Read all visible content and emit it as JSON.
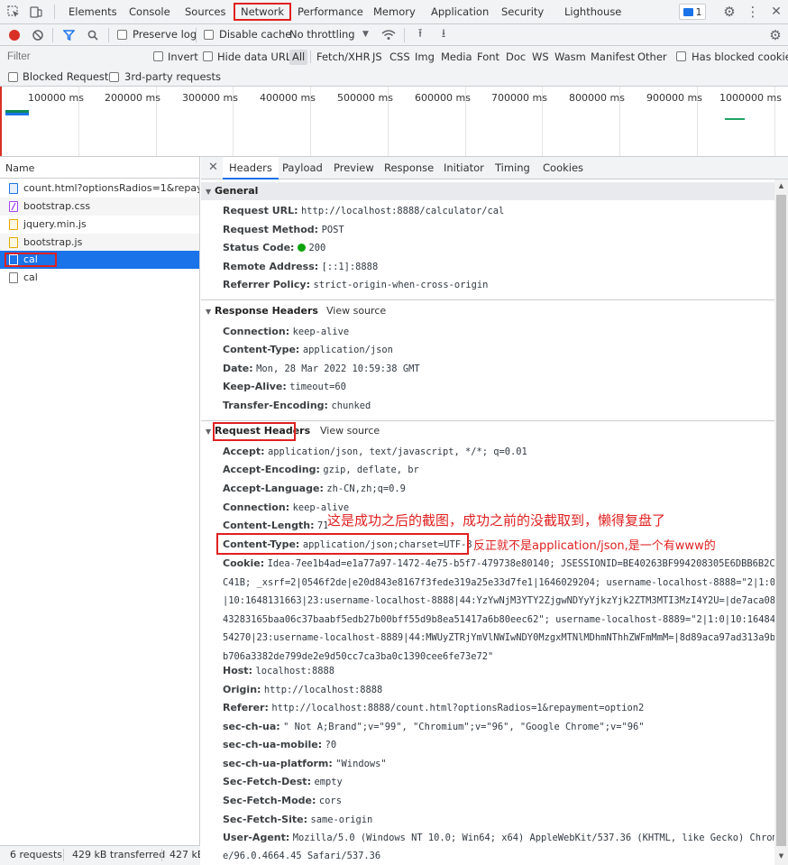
{
  "main_tabs": [
    "Elements",
    "Console",
    "Sources",
    "Network",
    "Performance",
    "Memory",
    "Application",
    "Security",
    "Lighthouse"
  ],
  "active_tab": "Network",
  "issues_count": "1",
  "toolbar": {
    "preserve_log": "Preserve log",
    "disable_cache": "Disable cache",
    "throttling": "No throttling"
  },
  "filter": {
    "placeholder": "Filter",
    "invert": "Invert",
    "hide_data_urls": "Hide data URLs",
    "types": [
      "All",
      "Fetch/XHR",
      "JS",
      "CSS",
      "Img",
      "Media",
      "Font",
      "Doc",
      "WS",
      "Wasm",
      "Manifest",
      "Other"
    ],
    "has_blocked_cookies": "Has blocked cookies",
    "blocked_requests": "Blocked Requests",
    "third_party": "3rd-party requests"
  },
  "overview_ticks": [
    "100000 ms",
    "200000 ms",
    "300000 ms",
    "400000 ms",
    "500000 ms",
    "600000 ms",
    "700000 ms",
    "800000 ms",
    "900000 ms",
    "1000000 ms"
  ],
  "requests": {
    "header": "Name",
    "items": [
      {
        "name": "count.html?optionsRadios=1&repay...",
        "type": "doc"
      },
      {
        "name": "bootstrap.css",
        "type": "css"
      },
      {
        "name": "jquery.min.js",
        "type": "js"
      },
      {
        "name": "bootstrap.js",
        "type": "js"
      },
      {
        "name": "cal",
        "type": "xhr"
      },
      {
        "name": "cal",
        "type": "xhr"
      }
    ],
    "status": {
      "requests": "6 requests",
      "transferred": "429 kB transferred",
      "resources": "427 kB"
    }
  },
  "detail_tabs": [
    "Headers",
    "Payload",
    "Preview",
    "Response",
    "Initiator",
    "Timing",
    "Cookies"
  ],
  "general": {
    "title": "General",
    "rows": [
      {
        "k": "Request URL:",
        "v": "http://localhost:8888/calculator/cal"
      },
      {
        "k": "Request Method:",
        "v": "POST"
      },
      {
        "k": "Status Code:",
        "v": "200"
      },
      {
        "k": "Remote Address:",
        "v": "[::1]:8888"
      },
      {
        "k": "Referrer Policy:",
        "v": "strict-origin-when-cross-origin"
      }
    ]
  },
  "response_headers": {
    "title": "Response Headers",
    "view_source": "View source",
    "rows": [
      {
        "k": "Connection:",
        "v": "keep-alive"
      },
      {
        "k": "Content-Type:",
        "v": "application/json"
      },
      {
        "k": "Date:",
        "v": "Mon, 28 Mar 2022 10:59:38 GMT"
      },
      {
        "k": "Keep-Alive:",
        "v": "timeout=60"
      },
      {
        "k": "Transfer-Encoding:",
        "v": "chunked"
      }
    ]
  },
  "request_headers": {
    "title": "Request Headers",
    "view_source": "View source",
    "rows": [
      {
        "k": "Accept:",
        "v": "application/json, text/javascript, */*; q=0.01"
      },
      {
        "k": "Accept-Encoding:",
        "v": "gzip, deflate, br"
      },
      {
        "k": "Accept-Language:",
        "v": "zh-CN,zh;q=0.9"
      },
      {
        "k": "Connection:",
        "v": "keep-alive"
      },
      {
        "k": "Content-Length:",
        "v": "71"
      },
      {
        "k": "Content-Type:",
        "v": "application/json;charset=UTF-8"
      },
      {
        "k": "Cookie:",
        "v": "Idea-7ee1b4ad=e1a77a97-1472-4e75-b5f7-479738e80140; JSESSIONID=BE40263BF994208305E6DBB6B2CA"
      },
      {
        "k": "",
        "v": "C41B; _xsrf=2|0546f2de|e20d843e8167f3fede319a25e33d7fe1|1646029204; username-localhost-8888=\"2|1:0"
      },
      {
        "k": "",
        "v": "|10:1648131663|23:username-localhost-8888|44:YzYwNjM3YTY2ZjgwNDYyYjkzYjk2ZTM3MTI3MzI4Y2U=|de7aca08"
      },
      {
        "k": "",
        "v": "43283165baa06c37baabf5edb27b00bff55d9b8ea51417a6b80eec62\"; username-localhost-8889=\"2|1:0|10:16484"
      },
      {
        "k": "",
        "v": "54270|23:username-localhost-8889|44:MWUyZTRjYmVlNWIwNDY0MzgxMTNlMDhmNThhZWFmMmM=|8d89aca97ad313a9b"
      },
      {
        "k": "",
        "v": "b706a3382de799de2e9d50cc7ca3ba0c1390cee6fe73e72\""
      },
      {
        "k": "Host:",
        "v": "localhost:8888"
      },
      {
        "k": "Origin:",
        "v": "http://localhost:8888"
      },
      {
        "k": "Referer:",
        "v": "http://localhost:8888/count.html?optionsRadios=1&repayment=option2"
      },
      {
        "k": "sec-ch-ua:",
        "v": "\" Not A;Brand\";v=\"99\", \"Chromium\";v=\"96\", \"Google Chrome\";v=\"96\""
      },
      {
        "k": "sec-ch-ua-mobile:",
        "v": "?0"
      },
      {
        "k": "sec-ch-ua-platform:",
        "v": "\"Windows\""
      },
      {
        "k": "Sec-Fetch-Dest:",
        "v": "empty"
      },
      {
        "k": "Sec-Fetch-Mode:",
        "v": "cors"
      },
      {
        "k": "Sec-Fetch-Site:",
        "v": "same-origin"
      },
      {
        "k": "User-Agent:",
        "v": "Mozilla/5.0 (Windows NT 10.0; Win64; x64) AppleWebKit/537.36 (KHTML, like Gecko) Chrom"
      },
      {
        "k": "",
        "v": "e/96.0.4664.45 Safari/537.36"
      }
    ]
  },
  "annotations": {
    "note1": "这是成功之后的截图，成功之前的没截取到，懒得复盘了",
    "note2": "反正就不是application/json,是一个有www的"
  },
  "colors": {
    "accent": "#1a73e8",
    "annotation": "#e02020",
    "status_ok": "#0ca40c",
    "record": "#d93025"
  }
}
